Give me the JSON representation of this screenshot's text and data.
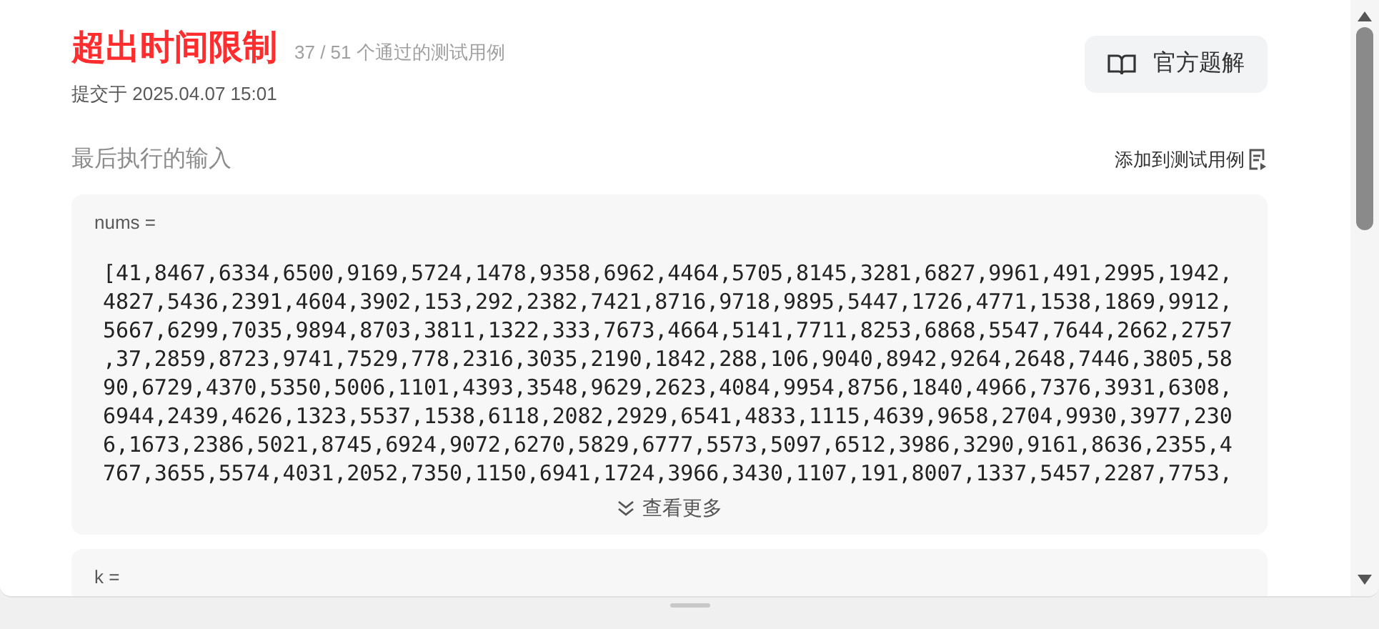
{
  "header": {
    "status": "超出时间限制",
    "passed": "37 / 51 个通过的测试用例",
    "submitted": "提交于 2025.04.07 15:01",
    "solution_button": "官方题解"
  },
  "last_input": {
    "title": "最后执行的输入",
    "add_link": "添加到测试用例",
    "params": [
      {
        "name": "nums =",
        "lines": [
          "[41,8467,6334,6500,9169,5724,1478,9358,6962,4464,5705,8145,3281,6827,9961,491,2995,1942,",
          "4827,5436,2391,4604,3902,153,292,2382,7421,8716,9718,9895,5447,1726,4771,1538,1869,9912,",
          "5667,6299,7035,9894,8703,3811,1322,333,7673,4664,5141,7711,8253,6868,5547,7644,2662,2757",
          ",37,2859,8723,9741,7529,778,2316,3035,2190,1842,288,106,9040,8942,9264,2648,7446,3805,58",
          "90,6729,4370,5350,5006,1101,4393,3548,9629,2623,4084,9954,8756,1840,4966,7376,3931,6308,",
          "6944,2439,4626,1323,5537,1538,6118,2082,2929,6541,4833,1115,4639,9658,2704,9930,3977,230",
          "6,1673,2386,5021,8745,6924,9072,6270,5829,6777,5573,5097,6512,3986,3290,9161,8636,2355,4",
          "767,3655,5574,4031,2052,7350,1150,6941,1724,3966,3430,1107,191,8007,1337,5457,2287,7753,"
        ],
        "more": "查看更多"
      },
      {
        "name": "k ="
      }
    ]
  }
}
